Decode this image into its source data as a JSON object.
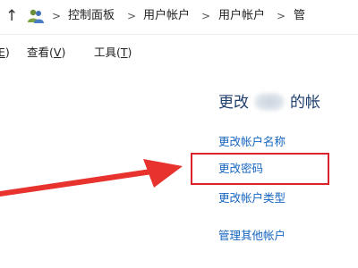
{
  "addressbar": {
    "up_glyph": "↑",
    "separator": ">",
    "breadcrumbs": [
      "控制面板",
      "用户帐户",
      "用户帐户",
      "管"
    ]
  },
  "menubar": {
    "items": [
      {
        "prefix": "",
        "key": "E",
        "suffix": ")"
      },
      {
        "prefix": "查看(",
        "key": "V",
        "suffix": ")"
      },
      {
        "prefix": "工具(",
        "key": "T",
        "suffix": ")"
      }
    ]
  },
  "main": {
    "heading_prefix": "更改",
    "heading_suffix": "的帐",
    "links": [
      "更改帐户名称",
      "更改密码",
      "更改帐户类型",
      "管理其他帐户"
    ]
  },
  "annotation": {
    "arrow_color": "#e8322e",
    "box_color": "#d9232d"
  },
  "icons": {
    "up": "arrow-up-icon",
    "address": "user-accounts-icon"
  }
}
